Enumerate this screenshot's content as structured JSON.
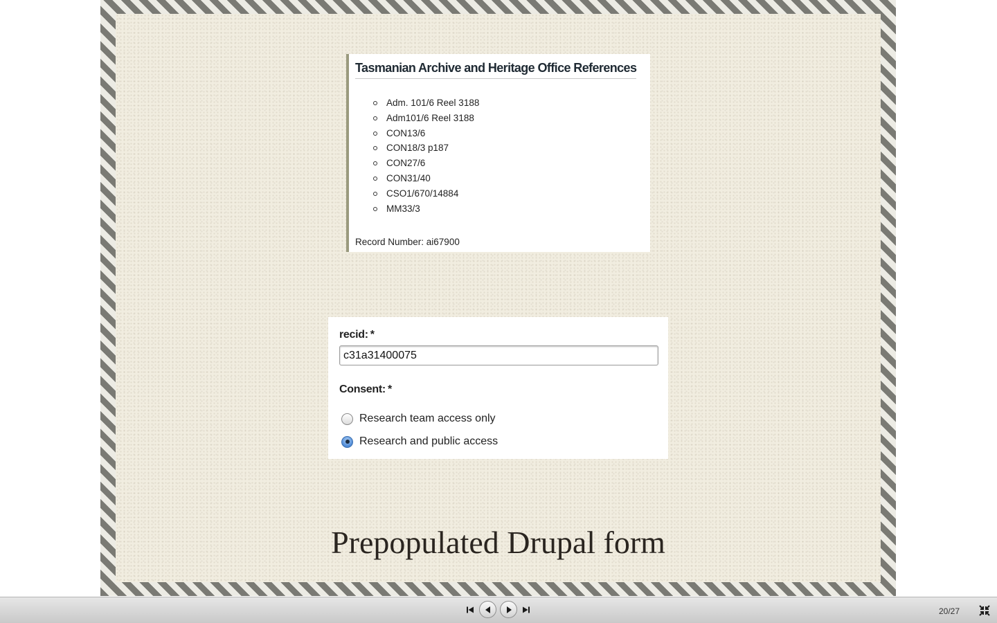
{
  "slide": {
    "reference_card": {
      "title": "Tasmanian Archive and Heritage Office References",
      "references": [
        "Adm. 101/6 Reel 3188",
        "Adm101/6 Reel 3188",
        "CON13/6",
        "CON18/3 p187",
        "CON27/6",
        "CON31/40",
        "CSO1/670/14884",
        "MM33/3"
      ],
      "record_number": "Record Number: ai67900"
    },
    "form": {
      "recid_label": "recid:",
      "required_marker": "*",
      "recid_value": "c31a31400075",
      "consent_label": "Consent:",
      "consent_options": [
        "Research team access only",
        "Research and public access"
      ],
      "consent_selected": "Research and public access"
    },
    "caption": "Prepopulated Drupal form"
  },
  "controls": {
    "page_counter": "20/27",
    "icons": {
      "first": "skip-to-first-icon",
      "prev": "previous-icon",
      "next": "next-icon",
      "last": "skip-to-last-icon",
      "fullscreen": "exit-fullscreen-icon"
    }
  },
  "colors": {
    "slide_background": "#f1ede0",
    "border_stripe": "#7a7a74",
    "control_bar": "#d6d6d6",
    "radio_selected": "#4f8ad6"
  }
}
